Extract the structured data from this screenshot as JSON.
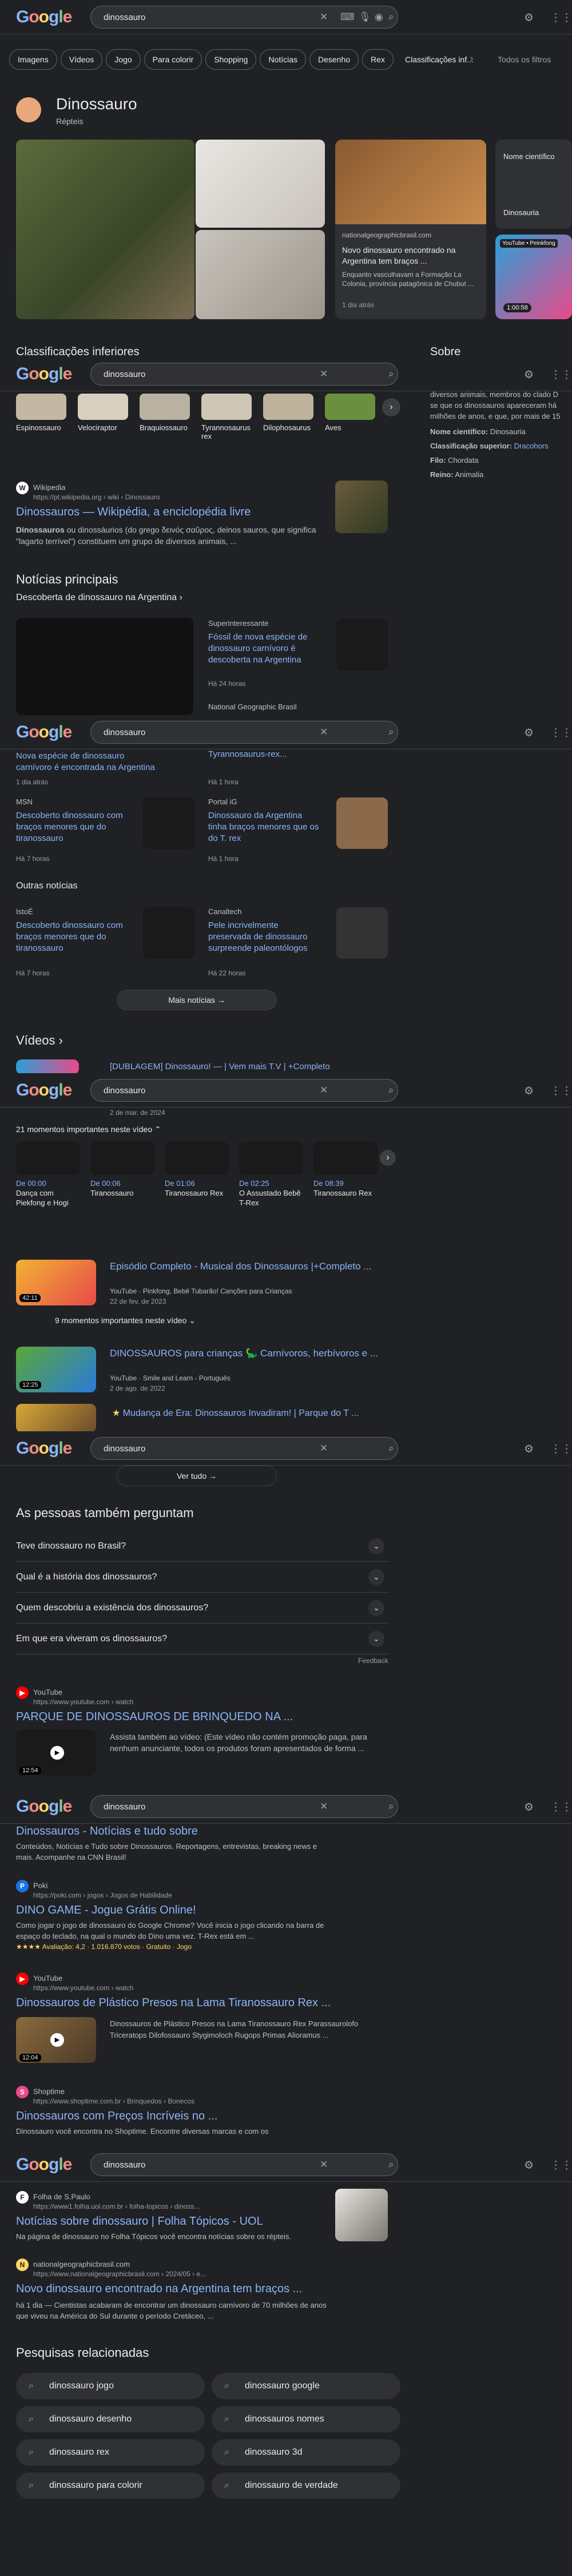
{
  "query": "dinossauro",
  "header": {
    "logo": "Google"
  },
  "tabs": [
    "Imagens",
    "Vídeos",
    "Jogo",
    "Para colorir",
    "Shopping",
    "Notícias",
    "Desenho",
    "Rex",
    "Classificações inf..."
  ],
  "all_filters": "Todos os filtros",
  "kp": {
    "title": "Dinossauro",
    "subtitle": "Répteis",
    "sci_card_label": "Nome científico",
    "sci_card_value": "Dinosauria",
    "news_source": "nationalgeographicbrasil.com",
    "news_title": "Novo dinossauro encontrado na Argentina tem braços ...",
    "news_snip": "Enquanto vasculhavam a Formação La Colonia, província patagônica de Chubut ...",
    "news_time": "1 dia atrás",
    "yt_label": "YouTube • Peinkfong",
    "yt_duration": "1:00:58"
  },
  "classif": {
    "title": "Classificações inferiores",
    "items": [
      "Espinossauro",
      "Velociraptor",
      "Braquiossauro",
      "Tyrannosaurus rex",
      "Dilophosaurus",
      "Aves"
    ]
  },
  "about": {
    "title": "Sobre",
    "text1": "diversos animais, membros do clado D",
    "text2": "se que os dinossauros apareceram há",
    "text3": "milhões de anos, e que, por mais de 15",
    "sci_label": "Nome científico:",
    "sci_value": "Dinosauria",
    "sup_label": "Classificação superior:",
    "sup_value": "Dracohors",
    "filo_label": "Filo:",
    "filo_value": "Chordata",
    "reino_label": "Reino:",
    "reino_value": "Animalia"
  },
  "wiki": {
    "source": "Wikipedia",
    "url": "https://pt.wikipedia.org › wiki › Dinossauro",
    "title": "Dinossauros — Wikipédia, a enciclopédia livre",
    "snip1_b": "Dinossauros",
    "snip1": " ou dinossáurios (do grego δεινός σαῦρος, deinos sauros, que significa",
    "snip2": "\"lagarto terrível\") constituem um grupo de diversos animais, ..."
  },
  "news": {
    "title": "Notícias principais",
    "sub": "Descoberta de dinossauro na Argentina",
    "n1_src": "Superinteressante",
    "n1_title": "Fóssil de nova espécie de dinossauro carnívoro é descoberta na Argentina",
    "n1_time": "Há 24 horas",
    "n2_src": "National Geographic Brasil",
    "n3_title": "Nova espécie de dinossauro carnívoro é encontrada na Argentina",
    "n3_time": "1 dia atrás",
    "n4_title": "Tyrannosaurus-rex...",
    "n4_time": "Há 1 hora",
    "n5_src": "MSN",
    "n5_title": "Descoberto dinossauro com braços menores que do tiranossauro",
    "n5_time": "Há 7 horas",
    "n6_src": "Portal iG",
    "n6_title": "Dinossauro da Argentina tinha braços menores que os do T. rex",
    "n6_time": "Há 1 hora",
    "other_title": "Outras notícias",
    "n7_src": "IstoÉ",
    "n7_title": "Descoberto dinossauro com braços menores que do tiranossauro",
    "n7_time": "Há 7 horas",
    "n8_src": "Canaltech",
    "n8_title": "Pele incrivelmente preservada de dinossauro surpreende paleontólogos",
    "n8_time": "Há 22 horas",
    "more": "Mais notícias"
  },
  "videos": {
    "title": "Vídeos",
    "v1_partial": "[DUBLAGEM] Dinossauro! — | Vem mais T.V | +Completo",
    "v1_date": "2 de mar. de 2024",
    "v1_moments": "21 momentos importantes neste vídeo",
    "moments": [
      {
        "t": "De 00:00",
        "l": "Dança com Piekfong e Hogi"
      },
      {
        "t": "De 00:06",
        "l": "Tiranossauro"
      },
      {
        "t": "De 01:06",
        "l": "Tiranossauro Rex"
      },
      {
        "t": "De 02:25",
        "l": "O Assustado Bebê T-Rex"
      },
      {
        "t": "De 08:39",
        "l": "Tiranossauro Rex"
      }
    ],
    "v2_title": "Episódio Completo - Musical dos Dinossauros |+Completo ...",
    "v2_meta": "YouTube · Pinkfong, Bebê Tubarão! Canções para Crianças",
    "v2_date": "22 de fev. de 2023",
    "v2_dur": "42:11",
    "v2_moments": "9 momentos importantes neste vídeo",
    "v3_title": "DINOSSAUROS para crianças 🦕 Carnívoros, herbívoros e ...",
    "v3_meta": "YouTube · Smile and Learn - Português",
    "v3_date": "2 de ago. de 2022",
    "v3_dur": "12:25",
    "v4_title": "Mudança de Era: Dinossauros Invadiram! | Parque do T ...",
    "see_all": "Ver tudo"
  },
  "paa": {
    "title": "As pessoas também perguntam",
    "q": [
      "Teve dinossauro no Brasil?",
      "Qual é a história dos dinossauros?",
      "Quem descobriu a existência dos dinossauros?",
      "Em que era viveram os dinossauros?"
    ],
    "feedback": "Feedback"
  },
  "yt1": {
    "src": "YouTube",
    "url": "https://www.youtube.com › watch",
    "title": "PARQUE DE DINOSSAUROS DE BRINQUEDO NA ...",
    "snip1": "Assista também ao vídeo: (Este vídeo não contém promoção paga, para",
    "snip2": "nenhum anunciante, todos os produtos foram apresentados de forma ...",
    "dur": "12:54"
  },
  "cnn": {
    "title": "Dinossauros - Notícias e tudo sobre",
    "snip1": "Conteúdos, Notícias e Tudo sobre Dinossauros. Reportagens, entrevistas, breaking news e",
    "snip2": "mais. Acompanhe na CNN Brasil!"
  },
  "poki": {
    "src": "Poki",
    "url": "https://poki.com › jogos › Jogos de Habilidade",
    "title": "DINO GAME - Jogue Grátis Online!",
    "snip1": "Como jogar o jogo de dinossauro do Google Chrome? Você inicia o jogo clicando na barra de",
    "snip2": "espaço do teclado, na qual o mundo do Dino uma vez. T-Rex está em ...",
    "rating": "★★★★ Avaliação: 4,2 · 1.016.870 votos · Gratuito · Jogo"
  },
  "yt2": {
    "src": "YouTube",
    "url": "https://www.youtube.com › watch",
    "title": "Dinossauros de Plástico Presos na Lama Tiranossauro Rex ...",
    "snip1": "Dinossauros de Plástico Presos na Lama Tiranossauro Rex Parassaurolofo",
    "snip2": "Triceratops Dilofossauro Stygimoloch Rugops Primas Alioramus ...",
    "dur": "12:04"
  },
  "shop": {
    "src": "Shoptime",
    "url": "https://www.shoptime.com.br › Brinquedos › Bonecos",
    "title": "Dinossauros com Preços Incríveis no ...",
    "snip": "Dinossauro você encontra no Shoptime. Encontre diversas marcas e com os"
  },
  "folha": {
    "src": "Folha de S.Paulo",
    "url": "https://www1.folha.uol.com.br › folha-topicos › dinoss...",
    "title": "Notícias sobre dinossauro | Folha Tópicos - UOL",
    "snip": "Na página de dinossauro no Folha Tópicos você encontra notícias sobre os répteis."
  },
  "natgeo": {
    "src": "nationalgeographicbrasil.com",
    "url": "https://www.nationalgeographicbrasil.com › 2024/05 › e...",
    "title": "Novo dinossauro encontrado na Argentina tem braços ...",
    "snip1": "há 1 dia — Cientistas acabaram de encontrar um dinossauro carnívoro de 70 milhões de anos",
    "snip2": "que viveu na América do Sul durante o período Cretáceo, ..."
  },
  "related": {
    "title": "Pesquisas relacionadas",
    "items": [
      "dinossauro jogo",
      "dinossauro google",
      "dinossauro desenho",
      "dinossauros nomes",
      "dinossauro rex",
      "dinossauro 3d",
      "dinossauro para colorir",
      "dinossauro de verdade"
    ]
  },
  "colors": {
    "bg": "#202124",
    "link": "#8ab4f8",
    "text": "#e8eaed",
    "muted": "#9aa0a6"
  }
}
